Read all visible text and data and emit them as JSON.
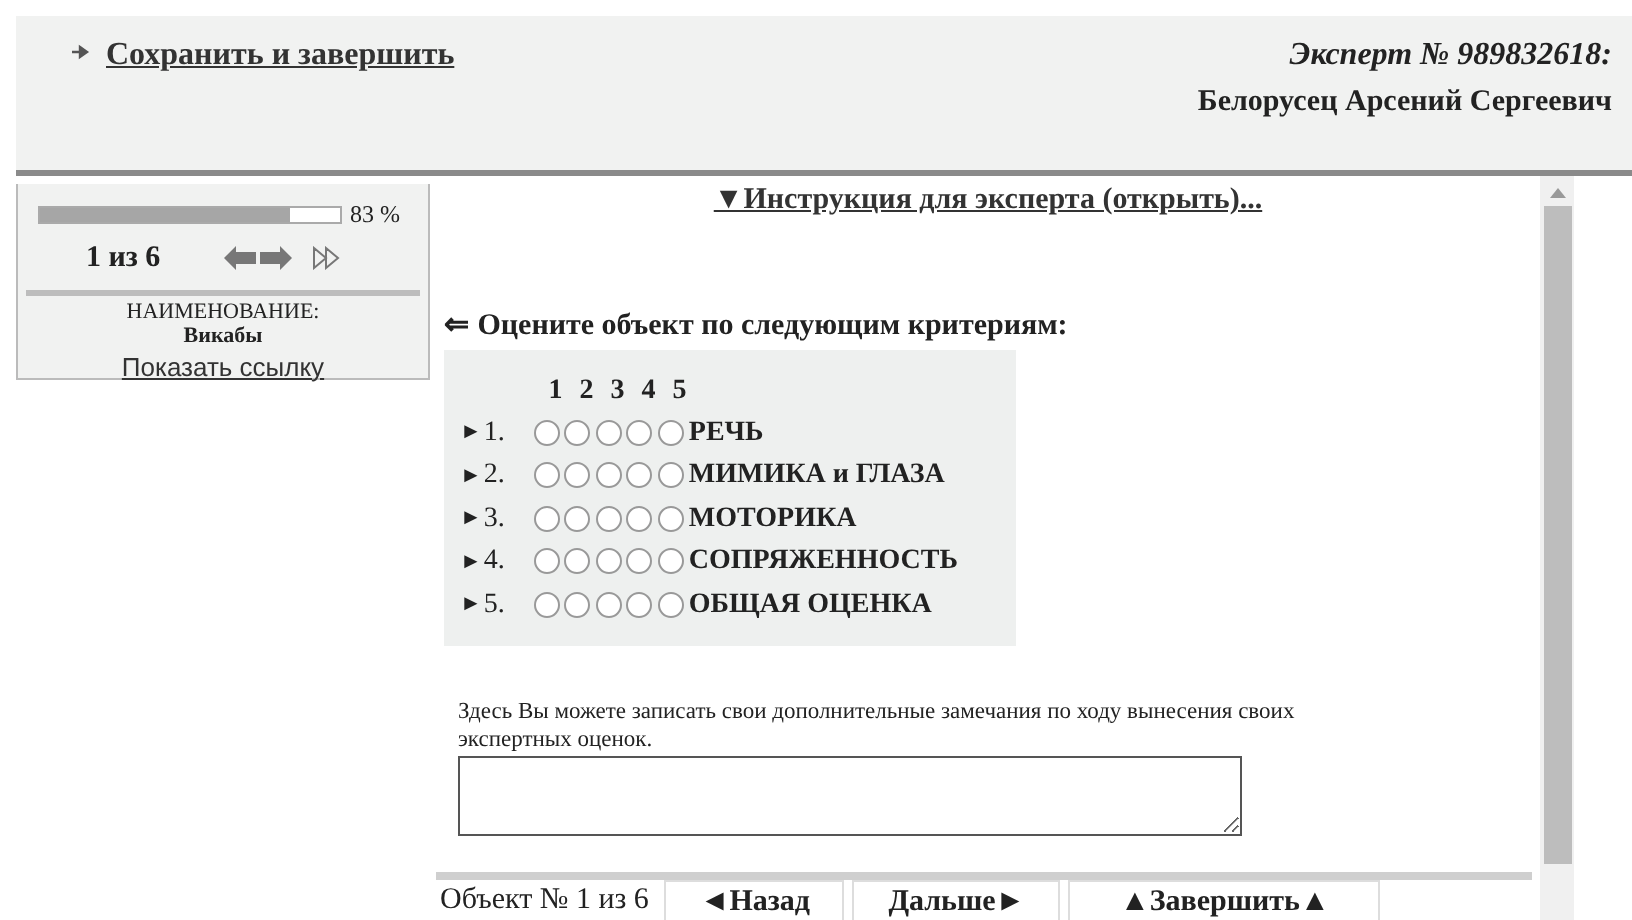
{
  "header": {
    "save_link": "Сохранить и завершить",
    "expert_label": "Эксперт № 989832618:",
    "expert_name": "Белорусец Арсений Сергеевич"
  },
  "side_panel": {
    "progress": {
      "level": 0.83,
      "reading": "83 %"
    },
    "position": "1 из 6",
    "name_label": "НАИМЕНОВАНИЕ:",
    "name_value": "Викабы",
    "show_link": "Показать ссылку"
  },
  "instruction_link": "▼Инструкция для эксперта (открыть)...",
  "criteria_prompt": "⇐ Оцените объект по следующим критериям:",
  "scale_headers": [
    "1",
    "2",
    "3",
    "4",
    "5"
  ],
  "criteria": [
    {
      "marker": "►",
      "number": "1.",
      "label": "РЕЧЬ",
      "choices": [
        {
          "selected": false
        },
        {
          "selected": false
        },
        {
          "selected": false
        },
        {
          "selected": false
        },
        {
          "selected": false
        }
      ]
    },
    {
      "marker": "►",
      "number": "2.",
      "label": "МИМИКА и ГЛАЗА",
      "choices": [
        {
          "selected": false
        },
        {
          "selected": false
        },
        {
          "selected": false
        },
        {
          "selected": false
        },
        {
          "selected": false
        }
      ]
    },
    {
      "marker": "►",
      "number": "3.",
      "label": "МОТОРИКА",
      "choices": [
        {
          "selected": false
        },
        {
          "selected": false
        },
        {
          "selected": false
        },
        {
          "selected": false
        },
        {
          "selected": false
        }
      ]
    },
    {
      "marker": "►",
      "number": "4.",
      "label": "СОПРЯЖЕННОСТЬ",
      "choices": [
        {
          "selected": false
        },
        {
          "selected": false
        },
        {
          "selected": false
        },
        {
          "selected": false
        },
        {
          "selected": false
        }
      ]
    },
    {
      "marker": "►",
      "number": "5.",
      "label": "ОБЩАЯ ОЦЕНКА",
      "choices": [
        {
          "selected": false
        },
        {
          "selected": false
        },
        {
          "selected": false
        },
        {
          "selected": false
        },
        {
          "selected": false
        }
      ]
    }
  ],
  "notes_hint": "Здесь Вы можете записать свои дополнительные замечания по ходу вынесения своих экспертных оценок.",
  "footer": {
    "object_counter": "Объект № 1 из 6",
    "buttons": [
      "◄Назад",
      "Дальше►",
      "▲Завершить▲"
    ]
  }
}
